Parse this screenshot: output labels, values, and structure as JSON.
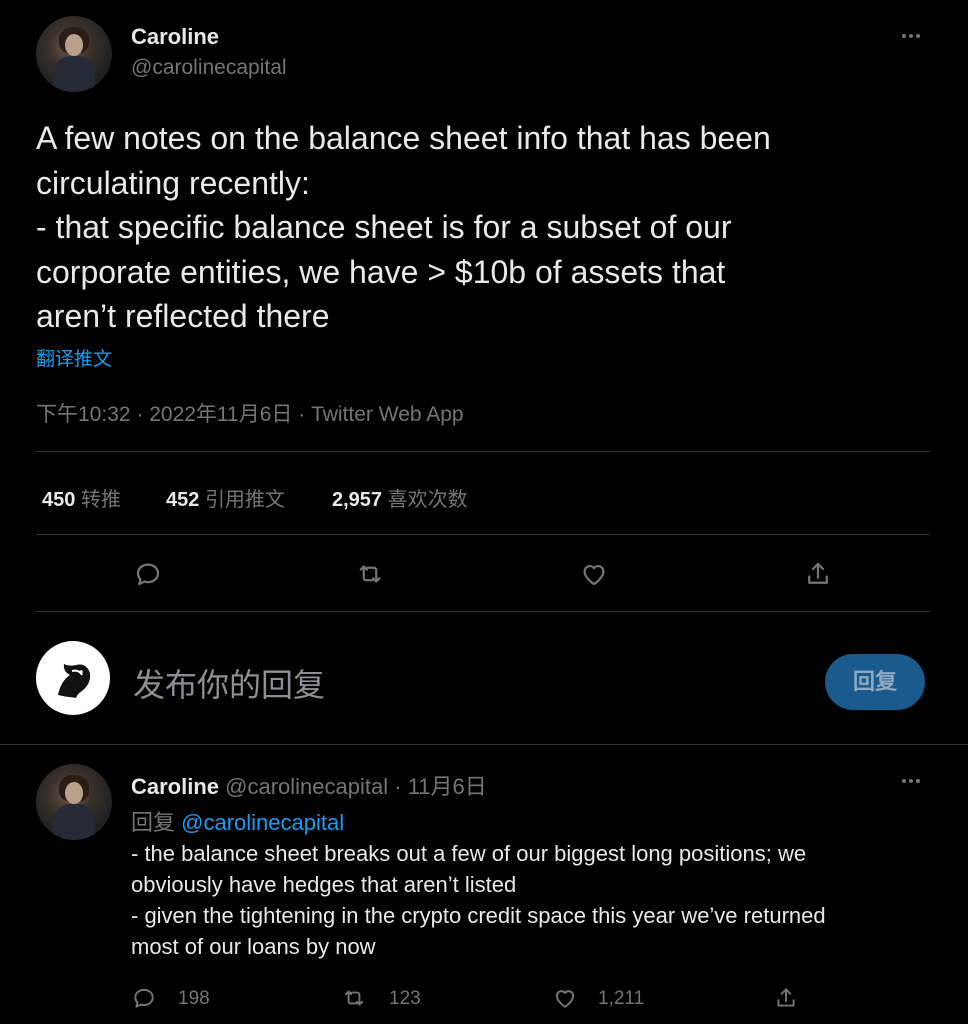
{
  "main_tweet": {
    "display_name": "Caroline",
    "handle": "@carolinecapital",
    "text": "A few notes on the balance sheet info that has been\ncirculating recently:\n- that specific balance sheet is for a subset of our\ncorporate entities, we have > $10b of assets that\naren’t reflected there",
    "translate_label": "翻译推文",
    "timestamp": "下午10:32 · 2022年11月6日 · Twitter Web App",
    "stats": {
      "retweets_count": "450",
      "retweets_label": "转推",
      "quotes_count": "452",
      "quotes_label": "引用推文",
      "likes_count": "2,957",
      "likes_label": "喜欢次数"
    }
  },
  "icons": {
    "reply": "reply-icon",
    "retweet": "retweet-icon",
    "like": "like-icon",
    "share": "share-icon",
    "more": "more-icon"
  },
  "compose": {
    "placeholder": "发布你的回复",
    "button_label": "回复"
  },
  "reply_tweet": {
    "display_name": "Caroline",
    "handle": "@carolinecapital",
    "date": "· 11月6日",
    "replying_to_label": "回复",
    "replying_to_handle": "@carolinecapital",
    "text": "- the balance sheet breaks out a few of our biggest long positions; we\nobviously have hedges that aren’t listed\n- given the tightening in the crypto credit space this year we’ve returned\nmost of our loans by now",
    "reply_count": "198",
    "retweet_count": "123",
    "like_count": "1,211"
  },
  "colors": {
    "background": "#000000",
    "text": "#e7e9ea",
    "muted": "#71767b",
    "accent": "#1d9bf0",
    "divider": "#2f3336"
  }
}
